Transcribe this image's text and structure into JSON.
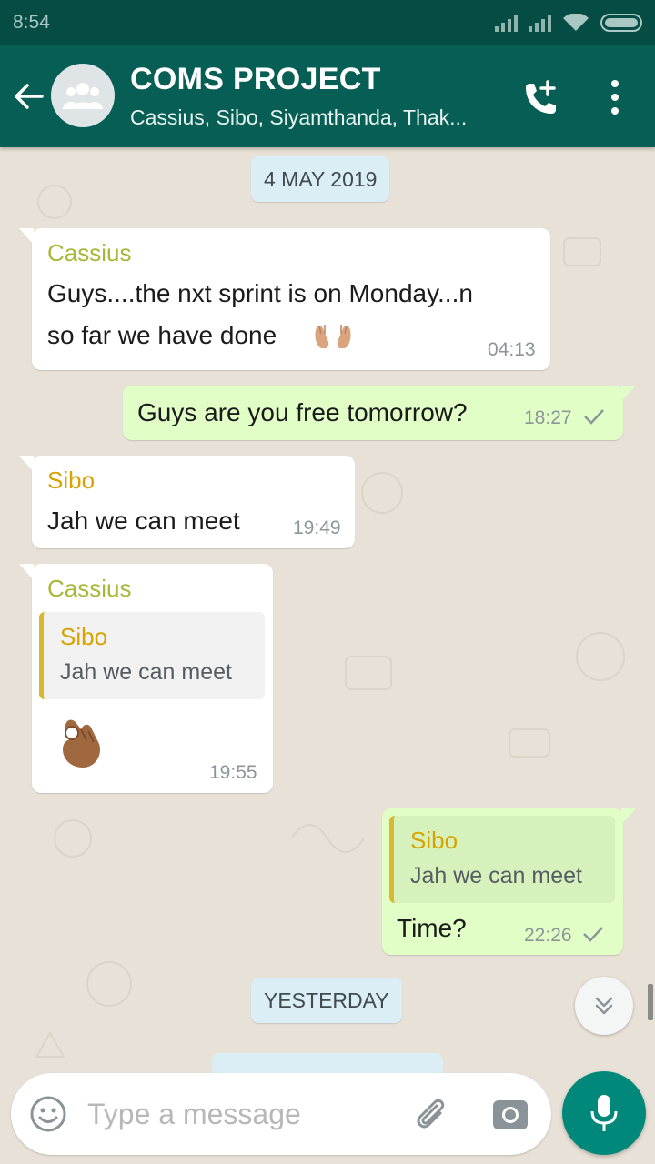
{
  "status_bar": {
    "time": "8:54"
  },
  "header": {
    "title": "COMS PROJECT",
    "subtitle": "Cassius, Sibo, Siyamthanda, Thak..."
  },
  "chat": {
    "date_1": "4 MAY 2019",
    "messages": [
      {
        "direction": "in",
        "sender": "Cassius",
        "text_line1": "Guys....the nxt sprint is on Monday...n",
        "text_line2": "so far we have done",
        "emoji": "open-hands",
        "time": "04:13"
      },
      {
        "direction": "out",
        "text": "Guys are you free tomorrow?",
        "time": "18:27",
        "status": "sent"
      },
      {
        "direction": "in",
        "sender": "Sibo",
        "text": "Jah we can meet",
        "time": "19:49"
      },
      {
        "direction": "in",
        "sender": "Cassius",
        "quote_name": "Sibo",
        "quote_text": "Jah we can meet",
        "emoji": "ok-hand",
        "time": "19:55"
      },
      {
        "direction": "out",
        "quote_name": "Sibo",
        "quote_text": "Jah we can meet",
        "text": "Time?",
        "time": "22:26",
        "status": "sent"
      }
    ],
    "date_2": "YESTERDAY"
  },
  "input": {
    "placeholder": "Type a message"
  },
  "colors": {
    "header": "#075e54",
    "status_bar": "#054d44",
    "outgoing_bubble": "#e1fec6",
    "incoming_bubble": "#ffffff",
    "sender_cassius": "#a8b83a",
    "sender_sibo": "#d6a300",
    "fab": "#00897b"
  },
  "icons": [
    "back-arrow-icon",
    "group-avatar-icon",
    "add-call-icon",
    "more-vert-icon",
    "emoji-icon",
    "attach-icon",
    "camera-icon",
    "mic-icon",
    "scroll-down-icon"
  ]
}
